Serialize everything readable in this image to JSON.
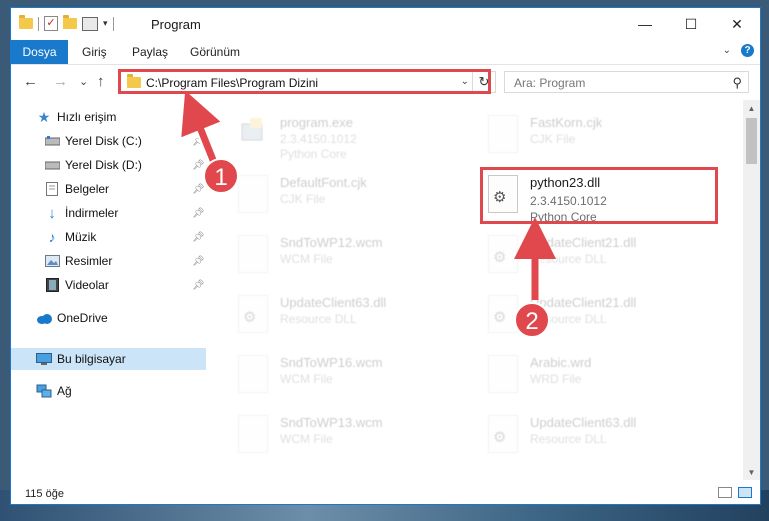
{
  "window": {
    "title": "Program",
    "minimize": "—",
    "maximize": "☐",
    "close": "✕"
  },
  "ribbon": {
    "file_tab": "Dosya",
    "tabs": [
      "Giriş",
      "Paylaş",
      "Görünüm"
    ],
    "help": "?"
  },
  "nav": {
    "back": "←",
    "forward": "→",
    "recent": "⌄",
    "up": "↑",
    "address": "C:\\Program Files\\Program Dizini",
    "refresh": "↻",
    "search_placeholder": "Ara: Program",
    "search_icon": "⚲"
  },
  "sidebar": {
    "items": [
      {
        "label": "Hızlı erişim",
        "icon": "star-icon"
      },
      {
        "label": "Yerel Disk (C:)",
        "icon": "drive-icon",
        "pinned": true
      },
      {
        "label": "Yerel Disk (D:)",
        "icon": "drive-icon",
        "pinned": true
      },
      {
        "label": "Belgeler",
        "icon": "documents-icon",
        "pinned": true
      },
      {
        "label": "İndirmeler",
        "icon": "download-icon",
        "pinned": true
      },
      {
        "label": "Müzik",
        "icon": "music-icon",
        "pinned": true
      },
      {
        "label": "Resimler",
        "icon": "pictures-icon",
        "pinned": true
      },
      {
        "label": "Videolar",
        "icon": "videos-icon",
        "pinned": true
      },
      {
        "label": "OneDrive",
        "icon": "cloud-icon"
      },
      {
        "label": "Bu bilgisayar",
        "icon": "computer-icon",
        "selected": true
      },
      {
        "label": "Ağ",
        "icon": "network-icon"
      }
    ]
  },
  "files": [
    {
      "name": "program.exe",
      "line1": "2.3.4150.1012",
      "line2": "Python Core"
    },
    {
      "name": "FastKorn.cjk",
      "line1": "CJK File",
      "line2": ""
    },
    {
      "name": "DefaultFont.cjk",
      "line1": "CJK File",
      "line2": ""
    },
    {
      "name": "python23.dll",
      "line1": "2.3.4150.1012",
      "line2": "Python Core"
    },
    {
      "name": "SndToWP12.wcm",
      "line1": "WCM File",
      "line2": ""
    },
    {
      "name": "UpdateClient21.dll",
      "line1": "Resource DLL",
      "line2": ""
    },
    {
      "name": "UpdateClient63.dll",
      "line1": "Resource DLL",
      "line2": ""
    },
    {
      "name": "UpdateClient21.dll",
      "line1": "Resource DLL",
      "line2": ""
    },
    {
      "name": "SndToWP16.wcm",
      "line1": "WCM File",
      "line2": ""
    },
    {
      "name": "Arabic.wrd",
      "line1": "WRD File",
      "line2": ""
    },
    {
      "name": "SndToWP13.wcm",
      "line1": "WCM File",
      "line2": ""
    },
    {
      "name": "UpdateClient63.dll",
      "line1": "Resource DLL",
      "line2": ""
    }
  ],
  "status": {
    "count": "115 öğe"
  },
  "annotations": {
    "step1": "1",
    "step2": "2"
  },
  "colors": {
    "accent": "#1979ca",
    "highlight": "#e0484d",
    "selected": "#cce4f7"
  }
}
